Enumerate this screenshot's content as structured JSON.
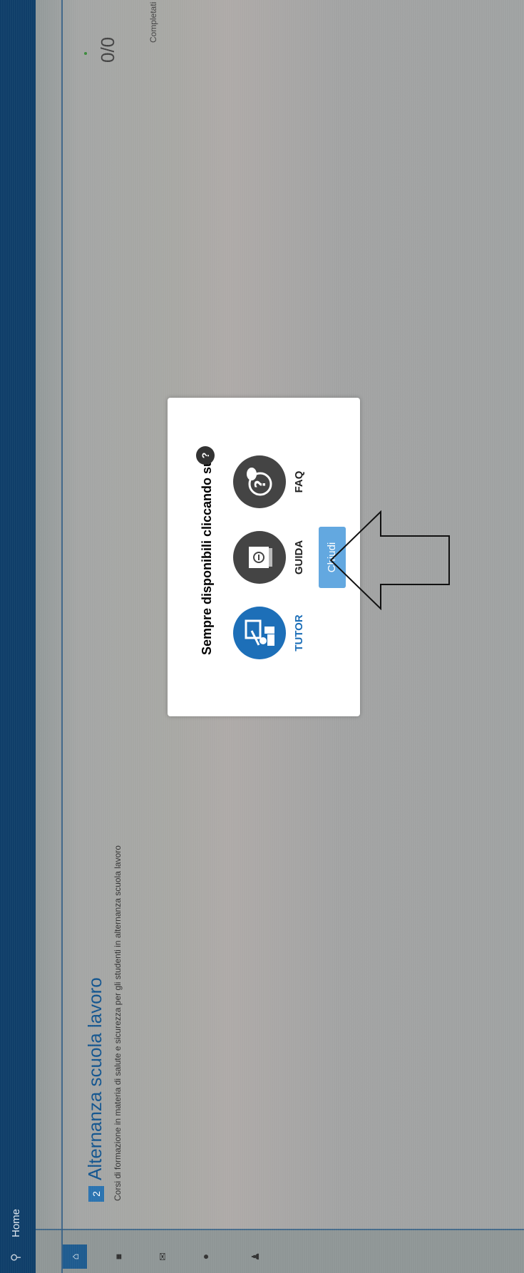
{
  "navbar": {
    "home_label": "Home"
  },
  "card": {
    "number": "2",
    "title": "Alternanza scuola lavoro",
    "subtitle": "Corsi di formazione in materia di salute e sicurezza per gli studenti in alternanza scuola lavoro",
    "score": "0/0",
    "completed_label": "Completati"
  },
  "modal": {
    "title": "Sempre disponibili cliccando su",
    "help_badge": "?",
    "options": [
      {
        "label": "TUTOR",
        "icon": "tutor-icon",
        "color": "#1d6fb8"
      },
      {
        "label": "GUIDA",
        "icon": "guide-icon",
        "color": "#444444"
      },
      {
        "label": "FAQ",
        "icon": "faq-icon",
        "color": "#444444"
      }
    ],
    "close_label": "Chiudi"
  },
  "colors": {
    "navbar": "#0f3e69",
    "accent": "#13558f",
    "button": "#63a8e0"
  }
}
